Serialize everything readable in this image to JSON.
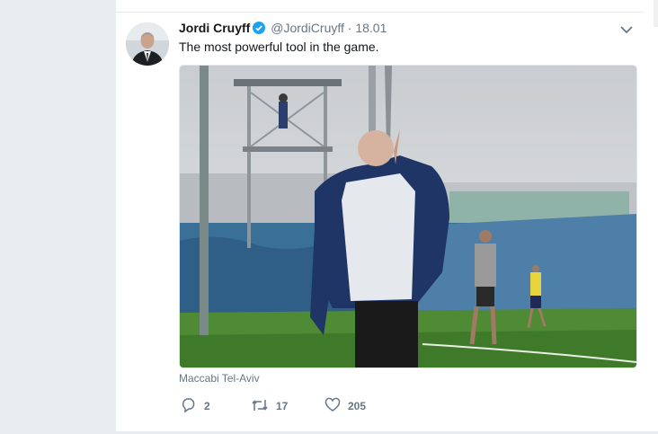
{
  "tweet": {
    "name": "Jordi Cruyff",
    "handle": "@JordiCruyff",
    "separator": "·",
    "time": "18.01",
    "text": "The most powerful tool in the game.",
    "media_caption": "Maccabi Tel-Aviv",
    "stats": {
      "replies": "2",
      "retweets": "17",
      "likes": "205"
    }
  },
  "colors": {
    "background": "#e6ecf0",
    "card": "#ffffff",
    "secondary_text": "#657786",
    "verified": "#1da1f2"
  },
  "icons": {
    "verified": "verified-badge-icon",
    "menu": "chevron-down-icon",
    "reply": "reply-icon",
    "retweet": "retweet-icon",
    "like": "heart-icon"
  }
}
